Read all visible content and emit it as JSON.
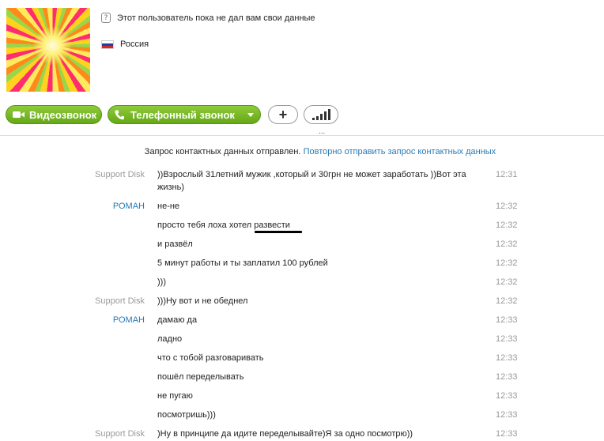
{
  "profile": {
    "status_text": "Этот пользователь пока не дал вам свои данные",
    "country": "Россия"
  },
  "toolbar": {
    "video_call_label": "Видеозвонок",
    "phone_call_label": "Телефонный звонок",
    "add_label": "+",
    "grip": "..."
  },
  "notice": {
    "text": "Запрос контактных данных отправлен.",
    "link": "Повторно отправить запрос контактных данных"
  },
  "messages": [
    {
      "sender": "Support Disk",
      "text": "))Взрослый 31летний мужик ,который и 30грн не может заработать ))Вот эта жизнь)",
      "time": "12:31"
    },
    {
      "sender": "РОМАН",
      "text": "не-не",
      "time": "12:32"
    },
    {
      "sender": "",
      "text": "просто тебя лоха хотел развести",
      "time": "12:32"
    },
    {
      "sender": "",
      "text": "и развёл",
      "time": "12:32"
    },
    {
      "sender": "",
      "text": "5 минут работы и ты заплатил 100 рублей",
      "time": "12:32"
    },
    {
      "sender": "",
      "text": ")))",
      "time": "12:32"
    },
    {
      "sender": "Support Disk",
      "text": ")))Ну вот и не обеднел",
      "time": "12:32"
    },
    {
      "sender": "РОМАН",
      "text": "дамаю да",
      "time": "12:33"
    },
    {
      "sender": "",
      "text": "ладно",
      "time": "12:33"
    },
    {
      "sender": "",
      "text": "что с тобой разговаривать",
      "time": "12:33"
    },
    {
      "sender": "",
      "text": "пошёл переделывать",
      "time": "12:33"
    },
    {
      "sender": "",
      "text": "не пугаю",
      "time": "12:33"
    },
    {
      "sender": "",
      "text": "посмотришь)))",
      "time": "12:33"
    },
    {
      "sender": "Support Disk",
      "text": ")Ну в принципе да идите переделывайте)Я за одно посмотрю))",
      "time": "12:33"
    }
  ],
  "colors": {
    "accent_green": "#65a817",
    "link_blue": "#2a7ab5",
    "muted_gray": "#9a9a9a"
  },
  "icons": [
    "question-icon",
    "russia-flag-icon",
    "video-camera-icon",
    "phone-icon",
    "chevron-down-icon",
    "plus-icon",
    "signal-bars-icon"
  ]
}
